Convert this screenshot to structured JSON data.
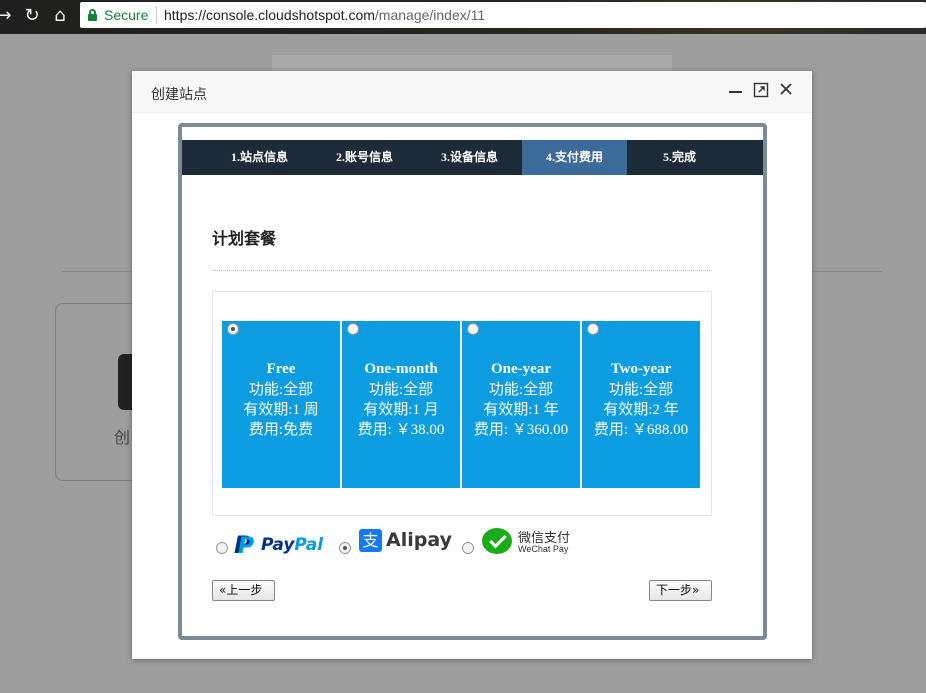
{
  "browser": {
    "secure_label": "Secure",
    "url_host": "https://console.cloudshotspot.com",
    "url_path": "/manage/index/11",
    "back_icon": "arrow-left-icon",
    "reload_icon": "reload-icon",
    "home_icon": "home-icon"
  },
  "background": {
    "card_label": "创"
  },
  "modal": {
    "title": "创建站点",
    "controls": [
      "minimize-icon",
      "maximize-icon",
      "close-icon"
    ]
  },
  "wizard": {
    "steps": [
      {
        "label": "1.站点信息",
        "active": false
      },
      {
        "label": "2.账号信息",
        "active": false
      },
      {
        "label": "3.设备信息",
        "active": false
      },
      {
        "label": "4.支付费用",
        "active": true
      },
      {
        "label": "5.完成",
        "active": false
      }
    ],
    "active_color": "#3c6a9a",
    "bar_color": "#1d2b39"
  },
  "section": {
    "title": "计划套餐"
  },
  "plans": {
    "color": "#0b9de0",
    "items": [
      {
        "name": "Free",
        "feature": "功能:全部",
        "validity": "有效期:1 周",
        "fee": "费用:免费",
        "selected": true
      },
      {
        "name": "One-month",
        "feature": "功能:全部",
        "validity": "有效期:1 月",
        "fee": "费用: ￥38.00",
        "selected": false
      },
      {
        "name": "One-year",
        "feature": "功能:全部",
        "validity": "有效期:1 年",
        "fee": "费用: ￥360.00",
        "selected": false
      },
      {
        "name": "Two-year",
        "feature": "功能:全部",
        "validity": "有效期:2 年",
        "fee": "费用: ￥688.00",
        "selected": false
      }
    ]
  },
  "payment": {
    "paypal": {
      "pay": "Pay",
      "pal": "Pal",
      "selected": false
    },
    "alipay": {
      "glyph": "支",
      "text": "Alipay",
      "selected": true
    },
    "wechat": {
      "cn": "微信支付",
      "en": "WeChat Pay",
      "selected": false
    }
  },
  "buttons": {
    "prev": "«上一步",
    "next": "下一步»"
  }
}
